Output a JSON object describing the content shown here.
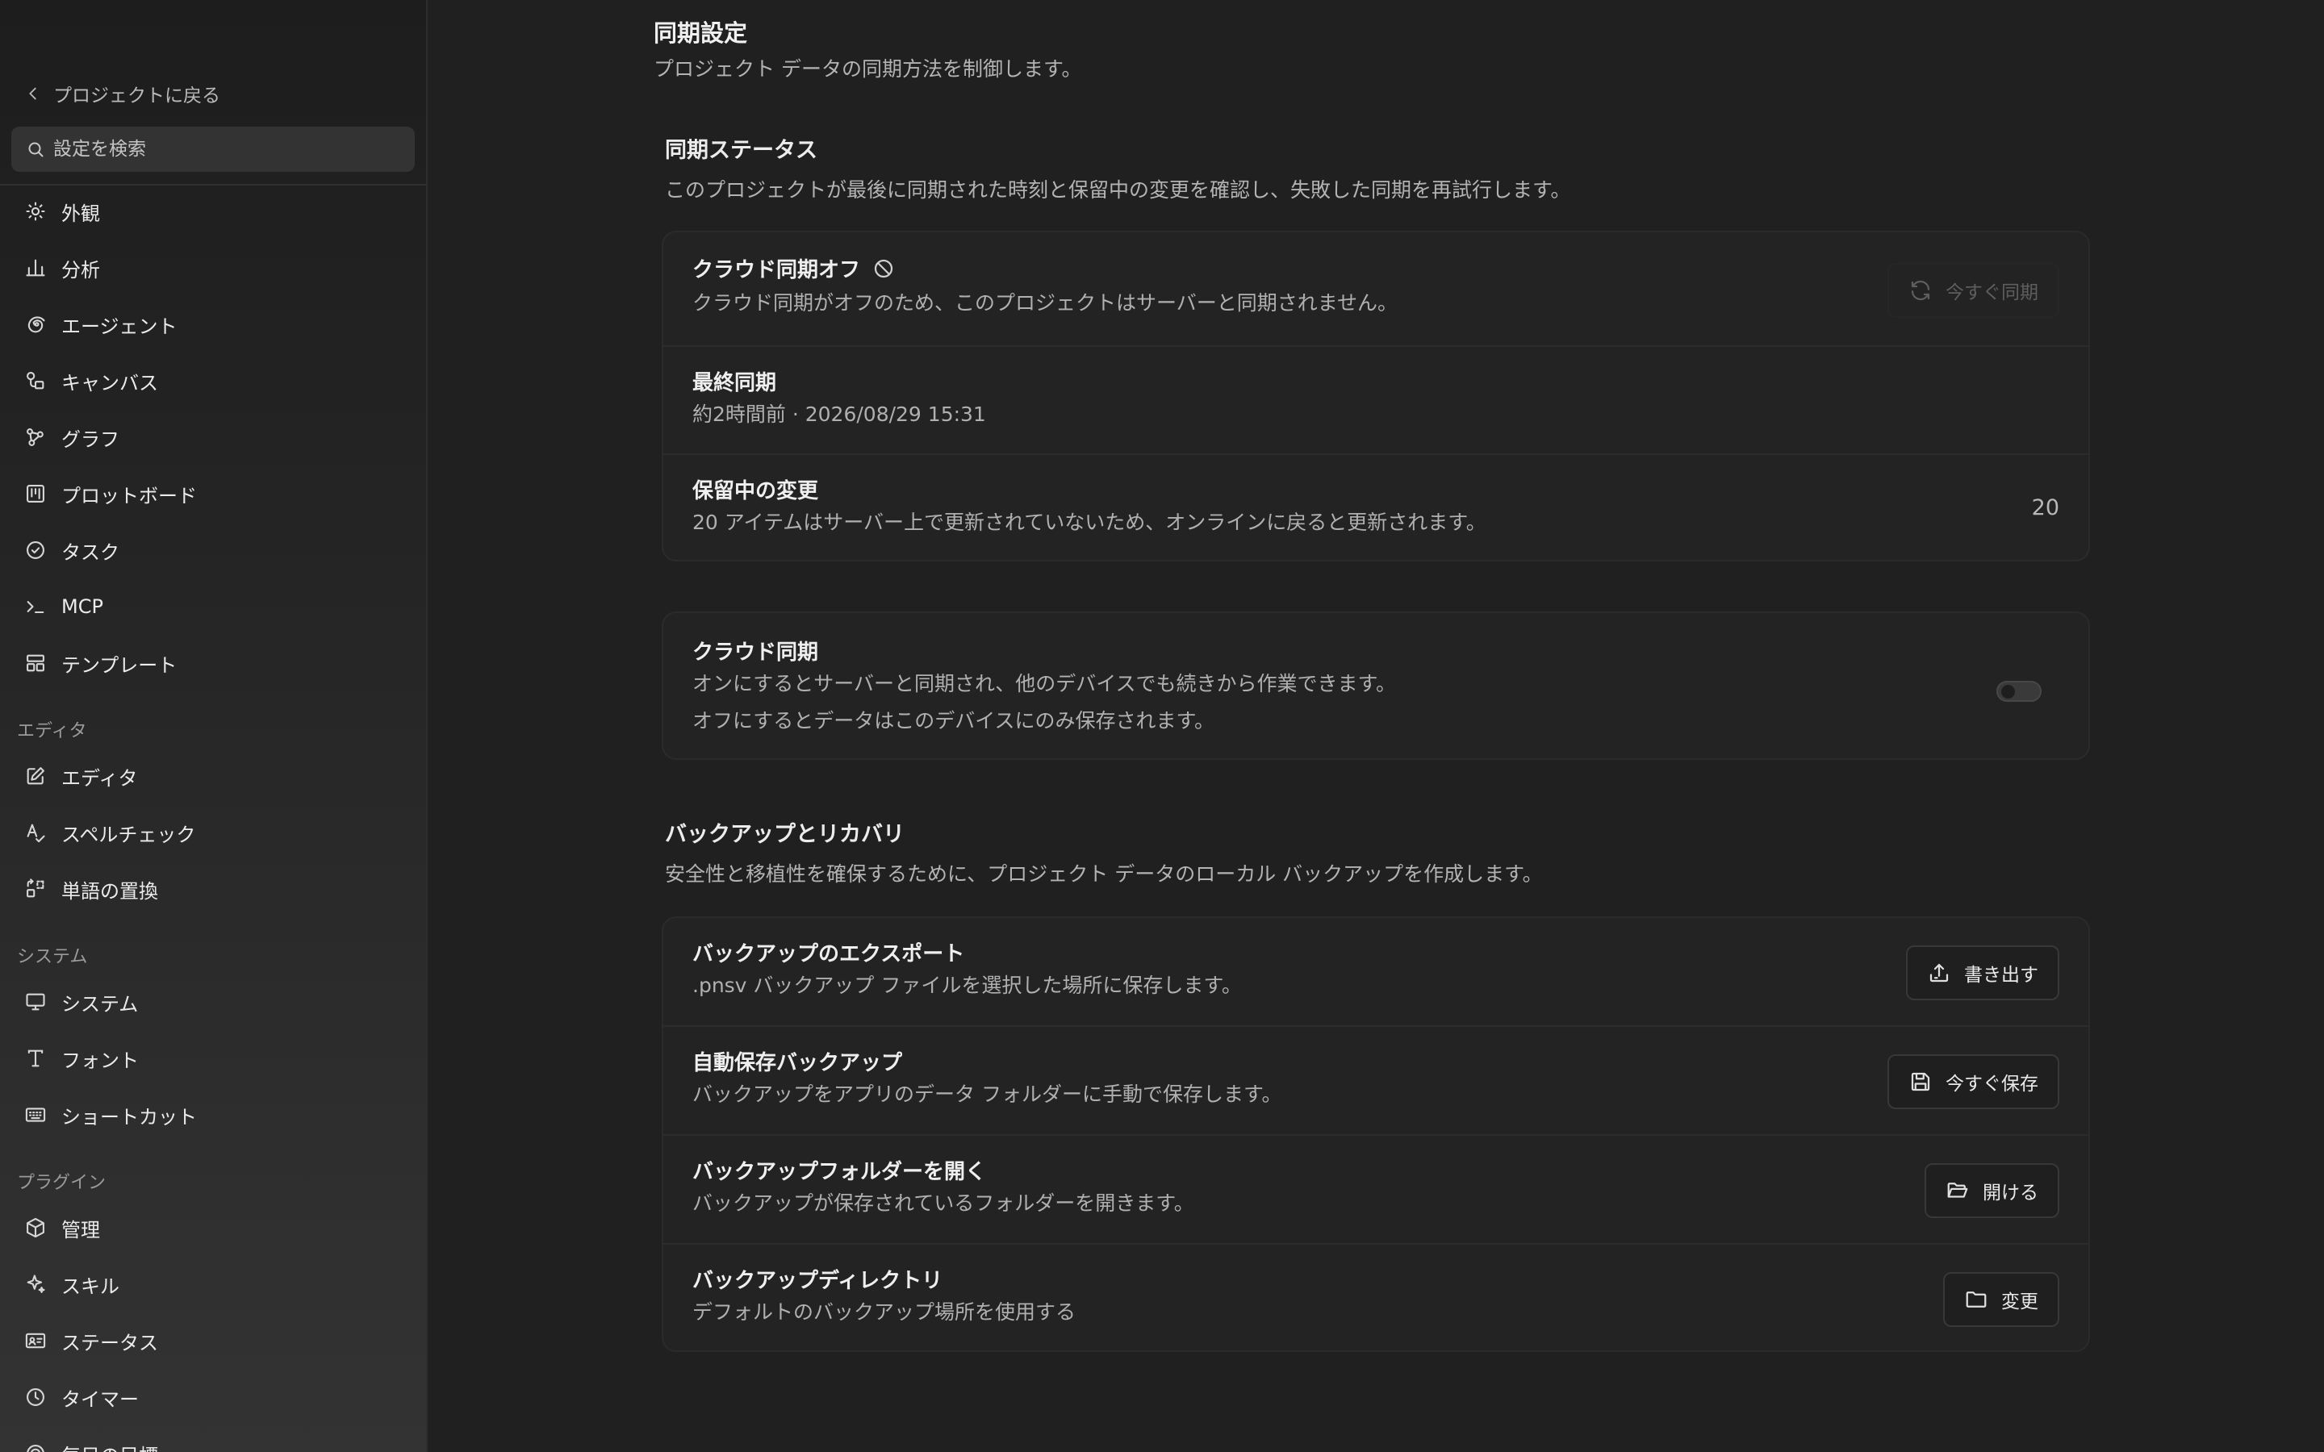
{
  "sidebar": {
    "back_label": "プロジェクトに戻る",
    "search_placeholder": "設定を検索",
    "groups": [
      {
        "items": [
          {
            "label": "外観",
            "icon": "sun-icon"
          },
          {
            "label": "分析",
            "icon": "bar-chart-icon"
          },
          {
            "label": "エージェント",
            "icon": "spiral-icon"
          },
          {
            "label": "キャンバス",
            "icon": "canvas-shapes-icon"
          },
          {
            "label": "グラフ",
            "icon": "graph-nodes-icon"
          },
          {
            "label": "プロットボード",
            "icon": "kanban-icon"
          },
          {
            "label": "タスク",
            "icon": "check-circle-icon"
          },
          {
            "label": "MCP",
            "icon": "terminal-icon"
          },
          {
            "label": "テンプレート",
            "icon": "layout-template-icon"
          }
        ]
      },
      {
        "title": "エディタ",
        "items": [
          {
            "label": "エディタ",
            "icon": "edit-square-icon"
          },
          {
            "label": "スペルチェック",
            "icon": "spell-check-icon"
          },
          {
            "label": "単語の置換",
            "icon": "replace-icon"
          }
        ]
      },
      {
        "title": "システム",
        "items": [
          {
            "label": "システム",
            "icon": "monitor-icon"
          },
          {
            "label": "フォント",
            "icon": "type-icon"
          },
          {
            "label": "ショートカット",
            "icon": "keyboard-icon"
          }
        ]
      },
      {
        "title": "プラグイン",
        "items": [
          {
            "label": "管理",
            "icon": "package-icon"
          },
          {
            "label": "スキル",
            "icon": "sparkle-icon"
          },
          {
            "label": "ステータス",
            "icon": "id-card-icon"
          },
          {
            "label": "タイマー",
            "icon": "clock-icon"
          },
          {
            "label": "毎日の目標",
            "icon": "target-icon"
          }
        ]
      }
    ]
  },
  "main": {
    "title": "同期設定",
    "description": "プロジェクト データの同期方法を制御します。",
    "sync_status": {
      "title": "同期ステータス",
      "description": "このプロジェクトが最後に同期された時刻と保留中の変更を確認し、失敗した同期を再試行します。",
      "cloud_off": {
        "title": "クラウド同期オフ",
        "description": "クラウド同期がオフのため、このプロジェクトはサーバーと同期されません。",
        "sync_now_label": "今すぐ同期"
      },
      "last_sync": {
        "title": "最終同期",
        "value": "約2時間前 · 2026/08/29 15:31"
      },
      "pending": {
        "title": "保留中の変更",
        "description": "20 アイテムはサーバー上で更新されていないため、オンラインに戻ると更新されます。",
        "count": "20"
      }
    },
    "cloud_sync": {
      "title": "クラウド同期",
      "description_line1": "オンにするとサーバーと同期され、他のデバイスでも続きから作業できます。",
      "description_line2": "オフにするとデータはこのデバイスにのみ保存されます。",
      "enabled": false
    },
    "backup": {
      "title": "バックアップとリカバリ",
      "description": "安全性と移植性を確保するために、プロジェクト データのローカル バックアップを作成します。",
      "export": {
        "title": "バックアップのエクスポート",
        "description": ".pnsv バックアップ ファイルを選択した場所に保存します。",
        "button": "書き出す"
      },
      "autosave": {
        "title": "自動保存バックアップ",
        "description": "バックアップをアプリのデータ フォルダーに手動で保存します。",
        "button": "今すぐ保存"
      },
      "open_folder": {
        "title": "バックアップフォルダーを開く",
        "description": "バックアップが保存されているフォルダーを開きます。",
        "button": "開ける"
      },
      "directory": {
        "title": "バックアップディレクトリ",
        "description": "デフォルトのバックアップ場所を使用する",
        "button": "変更"
      }
    }
  }
}
